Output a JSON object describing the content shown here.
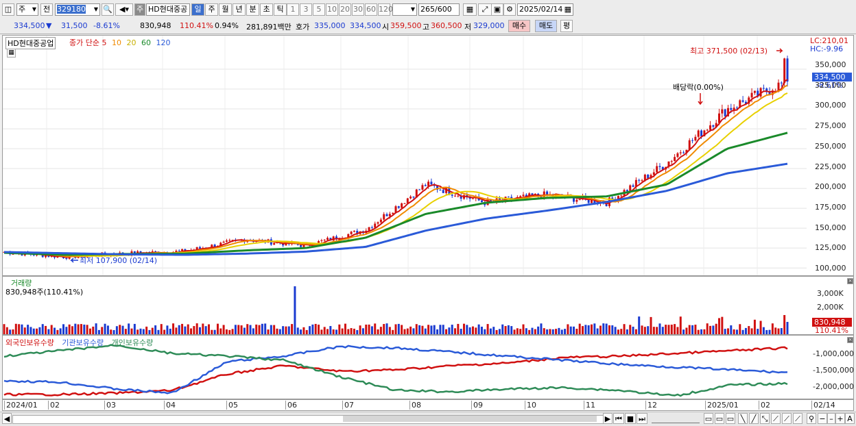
{
  "toolbar": {
    "market": "주",
    "prev": "전",
    "code": "329180",
    "sound_icon": "speaker-icon",
    "flag": "주",
    "name": "HD현대중공",
    "periods": [
      "일",
      "주",
      "월",
      "년",
      "분",
      "초",
      "틱"
    ],
    "selected_period": "일",
    "intervals": [
      "1",
      "3",
      "5",
      "10",
      "20",
      "30",
      "60",
      "120"
    ],
    "count": "265",
    "count_total": "/600",
    "date": "2025/02/14"
  },
  "info": {
    "price": "334,500",
    "change_arrow": "▼",
    "change": "31,500",
    "change_pct": "-8.61%",
    "volume": "830,948",
    "vol_ratio": "110.41%",
    "turnover": "0.94%",
    "amount": "281,891백만",
    "bid_label": "호가",
    "bid": "335,000",
    "ask": "334,500",
    "open_label": "시",
    "open": "359,500",
    "high_label": "고",
    "high": "360,500",
    "low_label": "저",
    "low": "329,000",
    "buy": "매수",
    "sell": "매도",
    "eval": "평"
  },
  "price_panel": {
    "stock_label": "HD현대중공업",
    "ma_prefix": "종가 단순",
    "ma_periods": [
      "5",
      "10",
      "20",
      "60",
      "120"
    ],
    "ma_colors": [
      "#d01010",
      "#f08a00",
      "#e8d000",
      "#1a8a2a",
      "#2a5ad8"
    ],
    "lc": "LC:210,01",
    "hc": "HC:-9.96",
    "current_tag": "334,500",
    "current_pct": "-8.61%",
    "max_label": "최고 371,500 (02/13)",
    "min_label": "최저 107,900 (02/14)",
    "dividend_label": "배당락(0.00%)",
    "y_ticks": [
      "350,000",
      "325,000",
      "300,000",
      "275,000",
      "250,000",
      "225,000",
      "200,000",
      "175,000",
      "150,000",
      "125,000",
      "100,000"
    ]
  },
  "volume_panel": {
    "title": "거래량",
    "value": "830,948주(110.41%)",
    "y_ticks": [
      "3,000K",
      "2,000K"
    ],
    "tag_value": "830,948",
    "tag_pct": "110.41%"
  },
  "holders_panel": {
    "legend": [
      "외국인보유수량",
      "기관보유수량",
      "개인보유수량"
    ],
    "colors": [
      "#d01010",
      "#2a5ad8",
      "#2e8b57"
    ],
    "y_ticks": [
      "-1,000,000",
      "-1,500,000",
      "-2,000,000"
    ]
  },
  "x_labels": [
    "2024/01",
    "02",
    "03",
    "04",
    "05",
    "06",
    "07",
    "08",
    "09",
    "10",
    "11",
    "12",
    "2025/01",
    "02",
    "02/14"
  ],
  "chart_data": {
    "type": "line",
    "ylim": [
      95000,
      375000
    ],
    "x": [
      "2024-01",
      "2024-02",
      "2024-03",
      "2024-04",
      "2024-05",
      "2024-06",
      "2024-07",
      "2024-08",
      "2024-09",
      "2024-10",
      "2024-11",
      "2024-12",
      "2025-01",
      "2025-02"
    ],
    "series": [
      {
        "name": "5",
        "values": [
          120000,
          114000,
          118000,
          121000,
          136000,
          128000,
          148000,
          205000,
          182000,
          192000,
          182000,
          232000,
          300000,
          334500
        ]
      },
      {
        "name": "120",
        "values": [
          120000,
          118500,
          117000,
          116500,
          118000,
          120500,
          126500,
          147000,
          162000,
          172000,
          183000,
          197000,
          219000,
          231000
        ]
      },
      {
        "name": "60",
        "values": [
          119000,
          116500,
          117500,
          118000,
          122000,
          125000,
          138000,
          168000,
          182000,
          188000,
          190000,
          205000,
          250000,
          270000
        ]
      }
    ],
    "max": {
      "value": 371500,
      "date": "02/13"
    },
    "min": {
      "value": 107900,
      "date": "02/14"
    }
  }
}
